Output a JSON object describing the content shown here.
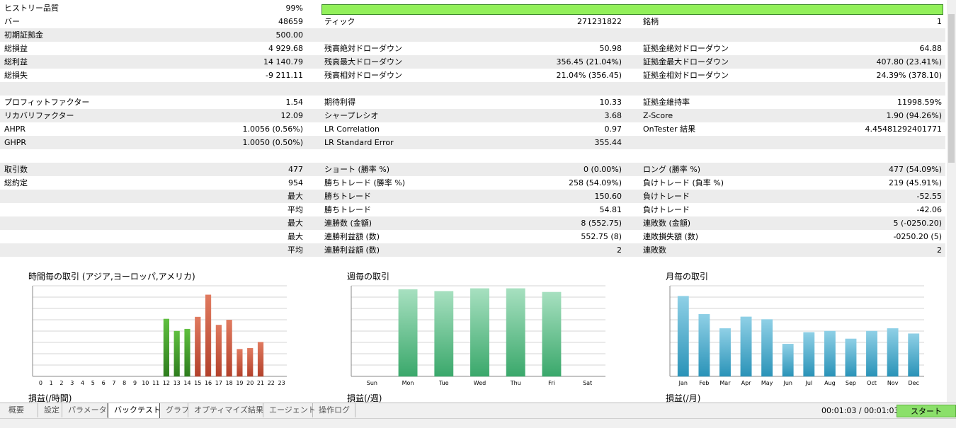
{
  "history_quality": {
    "label": "ヒストリー品質",
    "value": "99%",
    "fraction": 0.99
  },
  "stats": [
    {
      "shade": false,
      "c1l": "バー",
      "c1v": "48659",
      "c2l": "ティック",
      "c2v": "271231822",
      "c3l": "銘柄",
      "c3v": "1"
    },
    {
      "shade": true,
      "c1l": "初期証拠金",
      "c1v": "500.00",
      "c2l": "",
      "c2v": "",
      "c3l": "",
      "c3v": ""
    },
    {
      "shade": false,
      "c1l": "総損益",
      "c1v": "4 929.68",
      "c2l": "残高絶対ドローダウン",
      "c2v": "50.98",
      "c3l": "証拠金絶対ドローダウン",
      "c3v": "64.88"
    },
    {
      "shade": true,
      "c1l": "総利益",
      "c1v": "14 140.79",
      "c2l": "残高最大ドローダウン",
      "c2v": "356.45 (21.04%)",
      "c3l": "証拠金最大ドローダウン",
      "c3v": "407.80 (23.41%)"
    },
    {
      "shade": false,
      "c1l": "総損失",
      "c1v": "-9 211.11",
      "c2l": "残高相対ドローダウン",
      "c2v": "21.04% (356.45)",
      "c3l": "証拠金相対ドローダウン",
      "c3v": "24.39% (378.10)"
    },
    {
      "shade": true,
      "c1l": "",
      "c1v": "",
      "c2l": "",
      "c2v": "",
      "c3l": "",
      "c3v": ""
    },
    {
      "shade": false,
      "c1l": "プロフィットファクター",
      "c1v": "1.54",
      "c2l": "期待利得",
      "c2v": "10.33",
      "c3l": "証拠金維持率",
      "c3v": "11998.59%"
    },
    {
      "shade": true,
      "c1l": "リカバリファクター",
      "c1v": "12.09",
      "c2l": "シャープレシオ",
      "c2v": "3.68",
      "c3l": "Z-Score",
      "c3v": "1.90 (94.26%)"
    },
    {
      "shade": false,
      "c1l": "AHPR",
      "c1v": "1.0056 (0.56%)",
      "c2l": "LR Correlation",
      "c2v": "0.97",
      "c3l": "OnTester 結果",
      "c3v": "4.45481292401771"
    },
    {
      "shade": true,
      "c1l": "GHPR",
      "c1v": "1.0050 (0.50%)",
      "c2l": "LR Standard Error",
      "c2v": "355.44",
      "c3l": "",
      "c3v": ""
    },
    {
      "shade": false,
      "c1l": "",
      "c1v": "",
      "c2l": "",
      "c2v": "",
      "c3l": "",
      "c3v": ""
    },
    {
      "shade": true,
      "c1l": "取引数",
      "c1v": "477",
      "c2l": "ショート (勝率 %)",
      "c2v": "0 (0.00%)",
      "c3l": "ロング (勝率 %)",
      "c3v": "477 (54.09%)"
    },
    {
      "shade": false,
      "c1l": "総約定",
      "c1v": "954",
      "c2l": "勝ちトレード (勝率 %)",
      "c2v": "258 (54.09%)",
      "c3l": "負けトレード (負率 %)",
      "c3v": "219 (45.91%)"
    },
    {
      "shade": true,
      "c1l": "",
      "c1v": "最大",
      "c2l": "勝ちトレード",
      "c2v": "150.60",
      "c3l": "負けトレード",
      "c3v": "-52.55"
    },
    {
      "shade": false,
      "c1l": "",
      "c1v": "平均",
      "c2l": "勝ちトレード",
      "c2v": "54.81",
      "c3l": "負けトレード",
      "c3v": "-42.06"
    },
    {
      "shade": true,
      "c1l": "",
      "c1v": "最大",
      "c2l": "連勝数 (金額)",
      "c2v": "8 (552.75)",
      "c3l": "連敗数 (金額)",
      "c3v": "5 (-0250.20)"
    },
    {
      "shade": false,
      "c1l": "",
      "c1v": "最大",
      "c2l": "連勝利益額 (数)",
      "c2v": "552.75 (8)",
      "c3l": "連敗損失額 (数)",
      "c3v": "-0250.20 (5)"
    },
    {
      "shade": true,
      "c1l": "",
      "c1v": "平均",
      "c2l": "連勝利益額 (数)",
      "c2v": "2",
      "c3l": "連敗数",
      "c3v": "2"
    }
  ],
  "charts_title": {
    "hourly": "時間毎の取引 (アジア,ヨーロッパ,アメリカ)",
    "weekly": "週毎の取引",
    "monthly": "月毎の取引"
  },
  "charts_foot": {
    "hourly": "損益(/時間)",
    "weekly": "損益(/週)",
    "monthly": "損益(/月)"
  },
  "colors": {
    "profit_green": "#2e7d1e",
    "loss_red": "#b3412b",
    "week_green": "#3aa86b",
    "month_blue": "#2a93b8",
    "grid": "#d6d6d6"
  },
  "chart_data": [
    {
      "type": "bar",
      "title": "時間毎の取引 (アジア,ヨーロッパ,アメリカ)",
      "categories": [
        "0",
        "1",
        "2",
        "3",
        "4",
        "5",
        "6",
        "7",
        "8",
        "9",
        "10",
        "11",
        "12",
        "13",
        "14",
        "15",
        "16",
        "17",
        "18",
        "19",
        "20",
        "21",
        "22",
        "23"
      ],
      "values": [
        0,
        0,
        0,
        0,
        0,
        0,
        0,
        0,
        0,
        0,
        0,
        0,
        57,
        45,
        47,
        59,
        81,
        51,
        56,
        27,
        28,
        34,
        0,
        0
      ],
      "bar_colors": [
        "green",
        "green",
        "green",
        "green",
        "green",
        "green",
        "green",
        "green",
        "green",
        "green",
        "green",
        "green",
        "green",
        "green",
        "green",
        "red",
        "red",
        "red",
        "red",
        "red",
        "red",
        "red",
        "red",
        "red"
      ],
      "ylim": [
        0,
        90
      ],
      "yticks": [
        0,
        45,
        90
      ],
      "xlabel": "損益(/時間)"
    },
    {
      "type": "bar",
      "title": "週毎の取引",
      "categories": [
        "Sun",
        "Mon",
        "Tue",
        "Wed",
        "Thu",
        "Fri",
        "Sat"
      ],
      "values": [
        0,
        96,
        94,
        97,
        97,
        93,
        0
      ],
      "ylim": [
        0,
        100
      ],
      "yticks": [
        0,
        25,
        50,
        75,
        100
      ],
      "xlabel": "損益(/週)"
    },
    {
      "type": "bar",
      "title": "月毎の取引",
      "categories": [
        "Jan",
        "Feb",
        "Mar",
        "Apr",
        "May",
        "Jun",
        "Jul",
        "Aug",
        "Sep",
        "Oct",
        "Nov",
        "Dec"
      ],
      "values": [
        62,
        48,
        37,
        46,
        44,
        25,
        34,
        35,
        29,
        35,
        37,
        33
      ],
      "ylim": [
        0,
        70
      ],
      "yticks": [
        0,
        35,
        70
      ],
      "xlabel": "損益(/月)"
    }
  ],
  "tabs": [
    {
      "label": "概要",
      "active": false
    },
    {
      "label": "設定",
      "active": false
    },
    {
      "label": "パラメータ",
      "active": false
    },
    {
      "label": "バックテスト",
      "active": true
    },
    {
      "label": "グラフ",
      "active": false
    },
    {
      "label": "オプティマイズ結果",
      "active": false
    },
    {
      "label": "エージェント",
      "active": false
    },
    {
      "label": "操作ログ",
      "active": false
    }
  ],
  "timer": "00:01:03 / 00:01:03",
  "start_label": "スタート"
}
